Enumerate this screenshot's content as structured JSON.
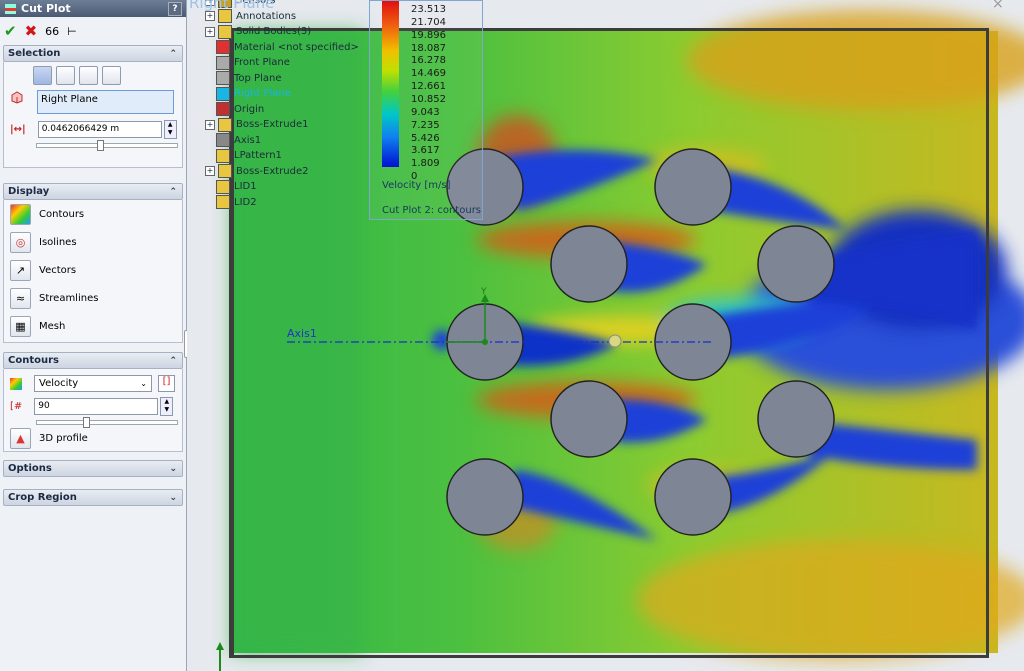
{
  "pm": {
    "title": "Cut Plot",
    "help": "?",
    "selection": {
      "header": "Selection",
      "plane": "Right Plane",
      "offset": "0.0462066429 m"
    },
    "display": {
      "header": "Display",
      "items": [
        "Contours",
        "Isolines",
        "Vectors",
        "Streamlines",
        "Mesh"
      ]
    },
    "contours": {
      "header": "Contours",
      "parameter": "Velocity",
      "levels": "90",
      "profile": "3D profile"
    },
    "options_header": "Options",
    "crop_header": "Crop Region"
  },
  "tree": {
    "items": [
      {
        "label": "Sensors",
        "expander": true
      },
      {
        "label": "Annotations",
        "expander": true
      },
      {
        "label": "Solid Bodies(3)",
        "expander": true
      },
      {
        "label": "Material <not specified>",
        "expander": false
      },
      {
        "label": "Front Plane",
        "expander": false
      },
      {
        "label": "Top Plane",
        "expander": false
      },
      {
        "label": "Right Plane",
        "expander": false,
        "highlight": true
      },
      {
        "label": "Origin",
        "expander": false
      },
      {
        "label": "Boss-Extrude1",
        "expander": true
      },
      {
        "label": "Axis1",
        "expander": false
      },
      {
        "label": "LPattern1",
        "expander": false
      },
      {
        "label": "Boss-Extrude2",
        "expander": true
      },
      {
        "label": "LID1",
        "expander": false
      },
      {
        "label": "LID2",
        "expander": false
      }
    ]
  },
  "legend": {
    "values": [
      "23.513",
      "21.704",
      "19.896",
      "18.087",
      "16.278",
      "14.469",
      "12.661",
      "10.852",
      "9.043",
      "7.235",
      "5.426",
      "3.617",
      "1.809",
      "0"
    ],
    "unit_label": "Velocity [m/s]",
    "caption": "Cut Plot 2: contours"
  },
  "graphics": {
    "axis_label": "Axis1",
    "y_label": "Y",
    "plane_label": "Right Plane"
  },
  "colors": {
    "tree_highlight": "#19b5e5",
    "cylinder": "#7e8595",
    "axis_line": "#1a2fcc"
  }
}
